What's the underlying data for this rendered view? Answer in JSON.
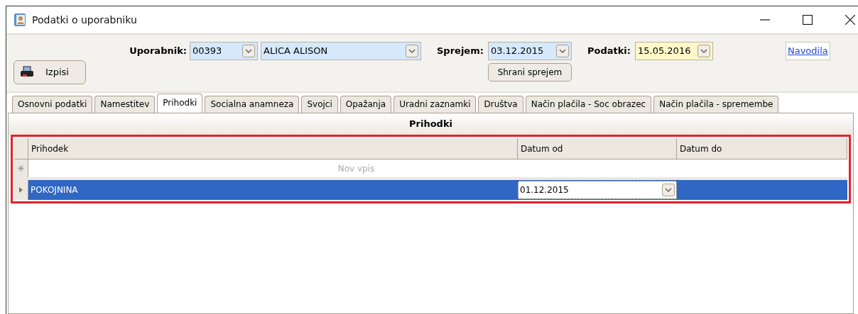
{
  "window": {
    "title": "Podatki o uporabniku"
  },
  "toolbar": {
    "print_button": "Izpisi",
    "user_label": "Uporabnik:",
    "user_id": "00393",
    "user_name": "ALICA ALISON",
    "admission_label": "Sprejem:",
    "admission_date": "03.12.2015",
    "save_admission_button": "Shrani sprejem",
    "data_label": "Podatki:",
    "data_date": "15.05.2016",
    "help_link": "Navodila"
  },
  "tabs": [
    {
      "label": "Osnovni podatki",
      "selected": false
    },
    {
      "label": "Namestitev",
      "selected": false
    },
    {
      "label": "Prihodki",
      "selected": true
    },
    {
      "label": "Socialna anamneza",
      "selected": false
    },
    {
      "label": "Svojci",
      "selected": false
    },
    {
      "label": "Opažanja",
      "selected": false
    },
    {
      "label": "Uradni zaznamki",
      "selected": false
    },
    {
      "label": "Društva",
      "selected": false
    },
    {
      "label": "Način plačila - Soc obrazec",
      "selected": false
    },
    {
      "label": "Način plačila - spremembe",
      "selected": false
    }
  ],
  "panel": {
    "title": "Prihodki",
    "table": {
      "columns": [
        "Prihodek",
        "Datum od",
        "Datum do"
      ],
      "new_row": "Nov vpis",
      "rows": [
        {
          "selected": true,
          "cells": [
            "POKOJNINA",
            "01.12.2015",
            ""
          ]
        }
      ]
    }
  }
}
